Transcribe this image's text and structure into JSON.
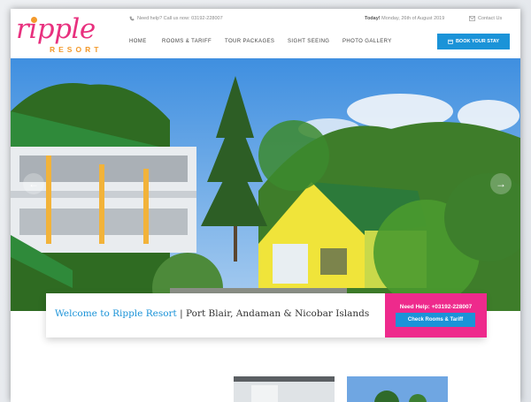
{
  "brand": {
    "logo_word": "ripple",
    "logo_sub": "RESORT"
  },
  "topbar": {
    "help_text": "Need help? Call us now: 03192-228007",
    "today_label": "Today!",
    "today_value": "Monday, 26th of August 2019",
    "contact_label": "Contact Us"
  },
  "nav": {
    "items": [
      {
        "label": "HOME"
      },
      {
        "label": "ROOMS & TARIFF"
      },
      {
        "label": "TOUR PACKAGES"
      },
      {
        "label": "SIGHT SEEING"
      },
      {
        "label": "PHOTO GALLERY"
      }
    ],
    "book_label": "BOOK YOUR STAY"
  },
  "hero": {
    "welcome_title": "Welcome to Ripple Resort",
    "welcome_sub": " | Port Blair, Andaman & Nicobar Islands",
    "help_label": "Need Help: +03192-228007",
    "check_label": "Check Rooms & Tariff"
  },
  "icons": {
    "phone": "phone-icon",
    "mail": "mail-icon",
    "calendar": "calendar-icon",
    "prev": "chevron-left-icon",
    "next": "chevron-right-icon"
  },
  "colors": {
    "brand_pink": "#e8307e",
    "brand_orange": "#f39a2c",
    "accent_blue": "#1b93d8",
    "help_pink": "#ee2a8c"
  }
}
